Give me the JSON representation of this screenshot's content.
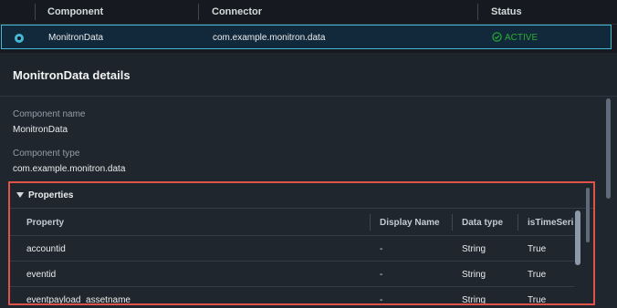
{
  "components_table": {
    "columns": [
      "Component",
      "Connector",
      "Status"
    ],
    "selected_row": {
      "component": "MonitronData",
      "connector": "com.example.monitron.data",
      "status": "ACTIVE"
    }
  },
  "details": {
    "title": "MonitronData details",
    "component_name_label": "Component name",
    "component_name": "MonitronData",
    "component_type_label": "Component type",
    "component_type": "com.example.monitron.data"
  },
  "properties": {
    "title": "Properties",
    "columns": [
      "Property",
      "Display Name",
      "Data type",
      "isTimeSeri"
    ],
    "rows": [
      {
        "property": "accountid",
        "display_name": "-",
        "data_type": "String",
        "is_time_series": "True"
      },
      {
        "property": "eventid",
        "display_name": "-",
        "data_type": "String",
        "is_time_series": "True"
      },
      {
        "property": "eventpayload_assetname",
        "display_name": "-",
        "data_type": "String",
        "is_time_series": "True"
      }
    ]
  },
  "colors": {
    "accent": "#44b9d6",
    "active": "#29ad32",
    "highlight_border": "#e05249"
  },
  "icons": [
    "radio-selected-icon",
    "check-circle-icon",
    "caret-down-icon"
  ]
}
